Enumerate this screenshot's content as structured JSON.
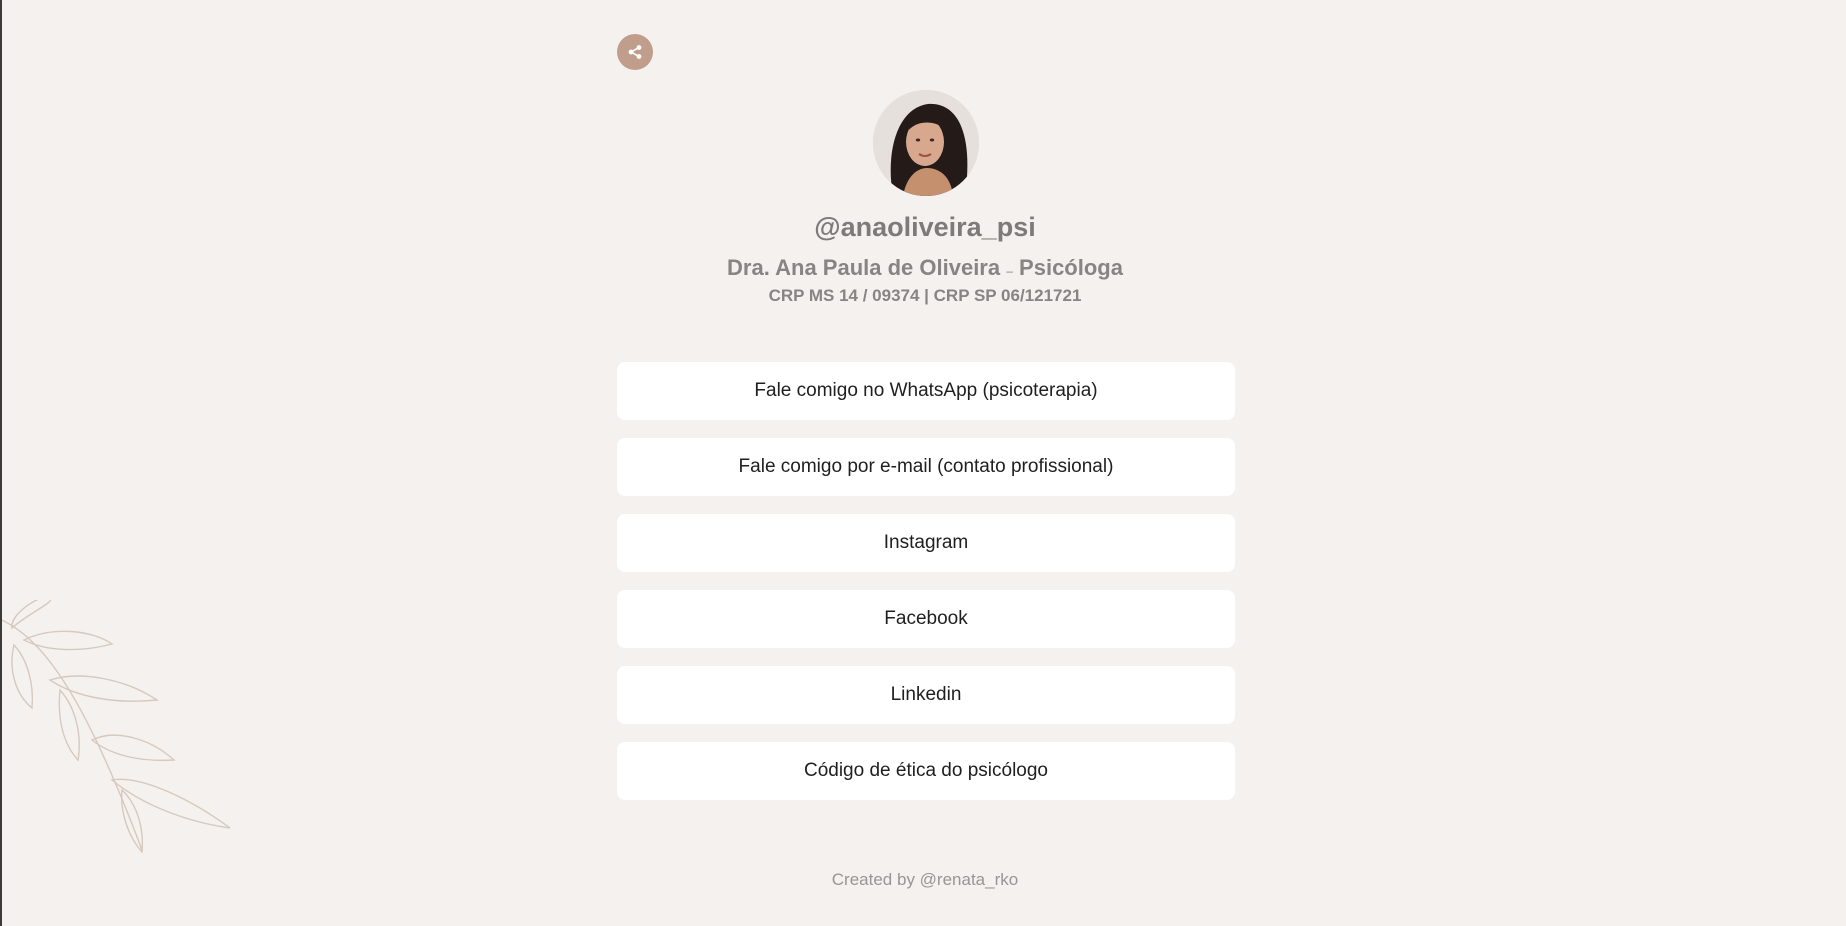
{
  "profile": {
    "handle": "@anaoliveira_psi",
    "name": "Dra. Ana Paula de Oliveira",
    "separator": "–",
    "title": "Psicóloga",
    "registration": "CRP MS 14 / 09374 | CRP SP 06/121721"
  },
  "links": [
    {
      "label": "Fale comigo no WhatsApp (psicoterapia)"
    },
    {
      "label": "Fale comigo por e-mail (contato profissional)"
    },
    {
      "label": "Instagram"
    },
    {
      "label": "Facebook"
    },
    {
      "label": "Linkedin"
    },
    {
      "label": "Código de ética do psicólogo"
    }
  ],
  "footer": {
    "text": "Created by @renata_rko"
  },
  "icons": {
    "share": "share-icon",
    "avatar": "profile-photo",
    "decoration": "leaf-branch"
  },
  "colors": {
    "background": "#f5f1ee",
    "accent": "#c19d8c",
    "button": "#ffffff"
  }
}
